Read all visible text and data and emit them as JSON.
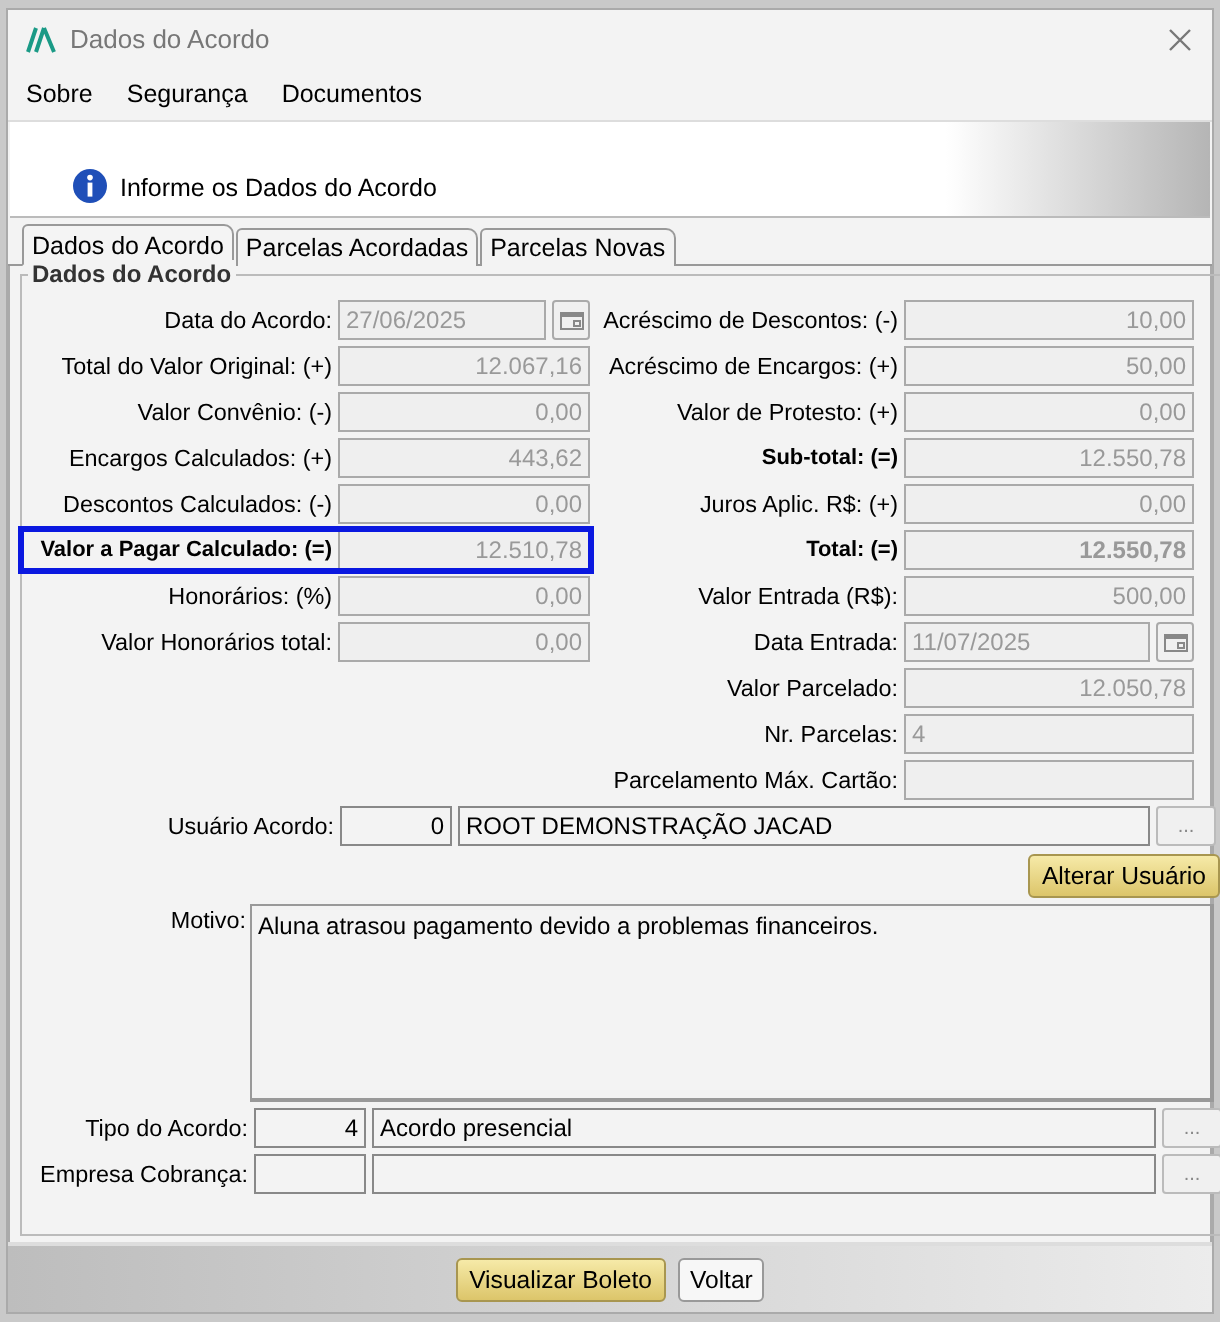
{
  "window": {
    "title": "Dados do Acordo"
  },
  "menu": [
    {
      "label": "Sobre"
    },
    {
      "label": "Segurança"
    },
    {
      "label": "Documentos"
    }
  ],
  "header": {
    "message": "Informe os Dados do Acordo"
  },
  "tabs": [
    {
      "label": "Dados do Acordo",
      "selected": true
    },
    {
      "label": "Parcelas Acordadas",
      "selected": false
    },
    {
      "label": "Parcelas Novas",
      "selected": false
    }
  ],
  "group": {
    "title": "Dados do Acordo"
  },
  "left_fields": [
    {
      "label": "Data do Acordo:",
      "value": "27/06/2025",
      "kind": "date",
      "bold": false,
      "highlighted": false
    },
    {
      "label": "Total do Valor Original: (+)",
      "value": "12.067,16",
      "kind": "number",
      "bold": false,
      "highlighted": false
    },
    {
      "label": "Valor Convênio: (-)",
      "value": "0,00",
      "kind": "number",
      "bold": false,
      "highlighted": false
    },
    {
      "label": "Encargos Calculados: (+)",
      "value": "443,62",
      "kind": "number",
      "bold": false,
      "highlighted": false
    },
    {
      "label": "Descontos Calculados: (-)",
      "value": "0,00",
      "kind": "number",
      "bold": false,
      "highlighted": false
    },
    {
      "label": "Valor a Pagar Calculado: (=)",
      "value": "12.510,78",
      "kind": "number",
      "bold": true,
      "highlighted": true
    },
    {
      "label": "Honorários: (%)",
      "value": "0,00",
      "kind": "number",
      "bold": false,
      "highlighted": false
    },
    {
      "label": "Valor Honorários total:",
      "value": "0,00",
      "kind": "number",
      "bold": false,
      "highlighted": false
    }
  ],
  "right_fields": [
    {
      "label": "Acréscimo de Descontos: (-)",
      "value": "10,00",
      "kind": "number",
      "bold": false,
      "value_bold": false
    },
    {
      "label": "Acréscimo de Encargos: (+)",
      "value": "50,00",
      "kind": "number",
      "bold": false,
      "value_bold": false
    },
    {
      "label": "Valor de Protesto: (+)",
      "value": "0,00",
      "kind": "number",
      "bold": false,
      "value_bold": false
    },
    {
      "label": "Sub-total: (=)",
      "value": "12.550,78",
      "kind": "number",
      "bold": true,
      "value_bold": false
    },
    {
      "label": "Juros Aplic. R$: (+)",
      "value": "0,00",
      "kind": "number",
      "bold": false,
      "value_bold": false
    },
    {
      "label": "Total: (=)",
      "value": "12.550,78",
      "kind": "number",
      "bold": true,
      "value_bold": true
    },
    {
      "label": "Valor Entrada (R$):",
      "value": "500,00",
      "kind": "number",
      "bold": false,
      "value_bold": false
    },
    {
      "label": "Data Entrada:",
      "value": "11/07/2025",
      "kind": "date",
      "bold": false,
      "value_bold": false
    },
    {
      "label": "Valor Parcelado:",
      "value": "12.050,78",
      "kind": "number",
      "bold": false,
      "value_bold": false
    },
    {
      "label": "Nr. Parcelas:",
      "value": "4",
      "kind": "text",
      "bold": false,
      "value_bold": false
    },
    {
      "label": "Parcelamento Máx. Cartão:",
      "kind": "text",
      "bold": false
    }
  ],
  "usuario": {
    "label": "Usuário Acordo:",
    "code": "0",
    "name": "ROOT DEMONSTRAÇÃO JACAD",
    "lookup": "...",
    "button": "Alterar Usuário"
  },
  "motivo": {
    "label": "Motivo:",
    "value": "Aluna atrasou pagamento devido a problemas financeiros."
  },
  "lookups": [
    {
      "label": "Tipo do Acordo:",
      "code": "4",
      "name": "Acordo presencial",
      "lookup": "..."
    },
    {
      "label": "Empresa Cobrança:",
      "lookup": "..."
    }
  ],
  "buttons": [
    {
      "label": "Visualizar Boleto",
      "kind": "primary"
    },
    {
      "label": "Voltar",
      "kind": "normal"
    }
  ]
}
